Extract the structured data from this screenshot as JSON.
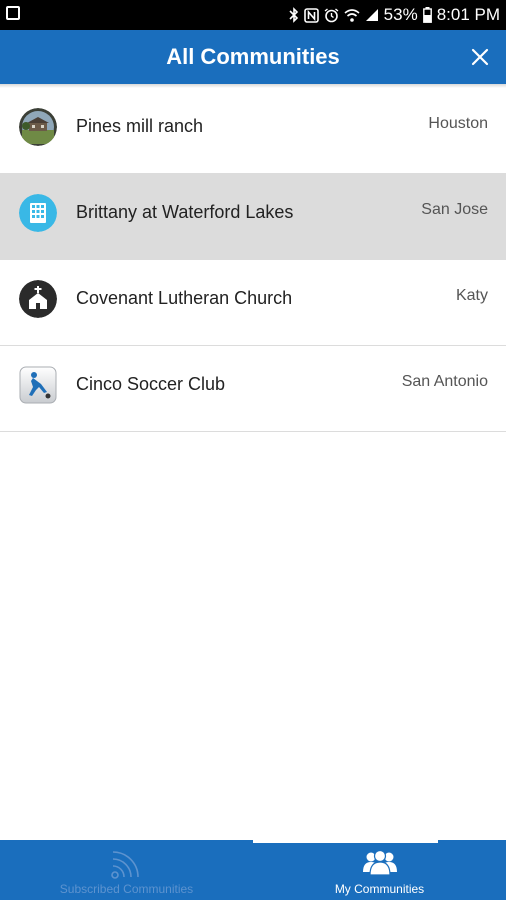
{
  "status_bar": {
    "battery": "53%",
    "time": "8:01 PM"
  },
  "header": {
    "title": "All Communities"
  },
  "communities": [
    {
      "name": "Pines mill ranch",
      "city": "Houston",
      "icon": "house-photo-icon"
    },
    {
      "name": "Brittany at Waterford Lakes",
      "city": "San Jose",
      "icon": "building-icon"
    },
    {
      "name": "Covenant Lutheran Church",
      "city": "Katy",
      "icon": "church-icon"
    },
    {
      "name": "Cinco Soccer Club",
      "city": "San Antonio",
      "icon": "soccer-player-icon"
    }
  ],
  "bottom_nav": {
    "tabs": [
      {
        "label": "Subscribed Communities",
        "icon": "rss-feed-icon",
        "active": false
      },
      {
        "label": "My Communities",
        "icon": "people-group-icon",
        "active": true
      }
    ]
  },
  "colors": {
    "primary": "#1a6ebd",
    "selected_row": "#dcdcdc"
  }
}
